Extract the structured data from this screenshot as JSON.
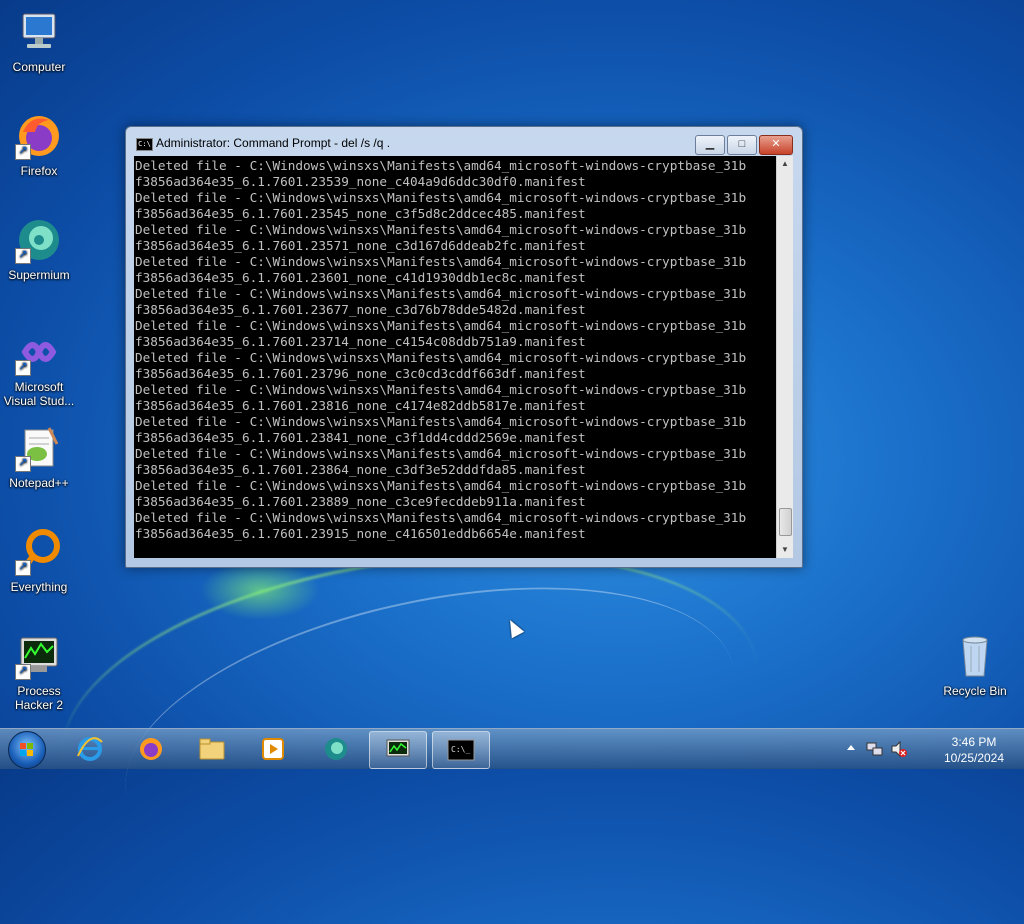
{
  "desktop": {
    "icons": [
      {
        "label": "Computer",
        "icon": "computer-icon"
      },
      {
        "label": "Firefox",
        "icon": "firefox-icon"
      },
      {
        "label": "Supermium",
        "icon": "supermium-icon"
      },
      {
        "label": "Microsoft Visual Stud...",
        "icon": "visual-studio-icon"
      },
      {
        "label": "Notepad++",
        "icon": "notepadpp-icon"
      },
      {
        "label": "Everything",
        "icon": "everything-icon"
      },
      {
        "label": "Process Hacker 2",
        "icon": "process-hacker-icon"
      },
      {
        "label": "Recycle Bin",
        "icon": "recycle-bin-icon"
      }
    ]
  },
  "window": {
    "title": "Administrator:  Command Prompt - del  /s /q .",
    "buttons": {
      "minimize": "▁",
      "maximize": "□",
      "close": "✕"
    },
    "lines": [
      "Deleted file - C:\\Windows\\winsxs\\Manifests\\amd64_microsoft-windows-cryptbase_31b",
      "f3856ad364e35_6.1.7601.23539_none_c404a9d6ddc30df0.manifest",
      "Deleted file - C:\\Windows\\winsxs\\Manifests\\amd64_microsoft-windows-cryptbase_31b",
      "f3856ad364e35_6.1.7601.23545_none_c3f5d8c2ddcec485.manifest",
      "Deleted file - C:\\Windows\\winsxs\\Manifests\\amd64_microsoft-windows-cryptbase_31b",
      "f3856ad364e35_6.1.7601.23571_none_c3d167d6ddeab2fc.manifest",
      "Deleted file - C:\\Windows\\winsxs\\Manifests\\amd64_microsoft-windows-cryptbase_31b",
      "f3856ad364e35_6.1.7601.23601_none_c41d1930ddb1ec8c.manifest",
      "Deleted file - C:\\Windows\\winsxs\\Manifests\\amd64_microsoft-windows-cryptbase_31b",
      "f3856ad364e35_6.1.7601.23677_none_c3d76b78dde5482d.manifest",
      "Deleted file - C:\\Windows\\winsxs\\Manifests\\amd64_microsoft-windows-cryptbase_31b",
      "f3856ad364e35_6.1.7601.23714_none_c4154c08ddb751a9.manifest",
      "Deleted file - C:\\Windows\\winsxs\\Manifests\\amd64_microsoft-windows-cryptbase_31b",
      "f3856ad364e35_6.1.7601.23796_none_c3c0cd3cddf663df.manifest",
      "Deleted file - C:\\Windows\\winsxs\\Manifests\\amd64_microsoft-windows-cryptbase_31b",
      "f3856ad364e35_6.1.7601.23816_none_c4174e82ddb5817e.manifest",
      "Deleted file - C:\\Windows\\winsxs\\Manifests\\amd64_microsoft-windows-cryptbase_31b",
      "f3856ad364e35_6.1.7601.23841_none_c3f1dd4cddd2569e.manifest",
      "Deleted file - C:\\Windows\\winsxs\\Manifests\\amd64_microsoft-windows-cryptbase_31b",
      "f3856ad364e35_6.1.7601.23864_none_c3df3e52dddfda85.manifest",
      "Deleted file - C:\\Windows\\winsxs\\Manifests\\amd64_microsoft-windows-cryptbase_31b",
      "f3856ad364e35_6.1.7601.23889_none_c3ce9fecddeb911a.manifest",
      "Deleted file - C:\\Windows\\winsxs\\Manifests\\amd64_microsoft-windows-cryptbase_31b",
      "f3856ad364e35_6.1.7601.23915_none_c416501eddb6654e.manifest"
    ]
  },
  "taskbar": {
    "items": [
      {
        "icon": "internet-explorer-icon",
        "active": false
      },
      {
        "icon": "firefox-icon",
        "active": false
      },
      {
        "icon": "file-explorer-icon",
        "active": false
      },
      {
        "icon": "media-player-icon",
        "active": false
      },
      {
        "icon": "supermium-icon",
        "active": false
      },
      {
        "icon": "process-hacker-icon",
        "active": true
      },
      {
        "icon": "command-prompt-icon",
        "active": true
      }
    ],
    "tray": {
      "time": "3:46 PM",
      "date": "10/25/2024",
      "icons": [
        "show-hidden-icons-icon",
        "network-icon",
        "volume-muted-icon"
      ]
    }
  },
  "colors": {
    "console_bg": "#000000",
    "console_fg": "#c0c0c0",
    "desktop_blue": "#1a6fc9"
  }
}
